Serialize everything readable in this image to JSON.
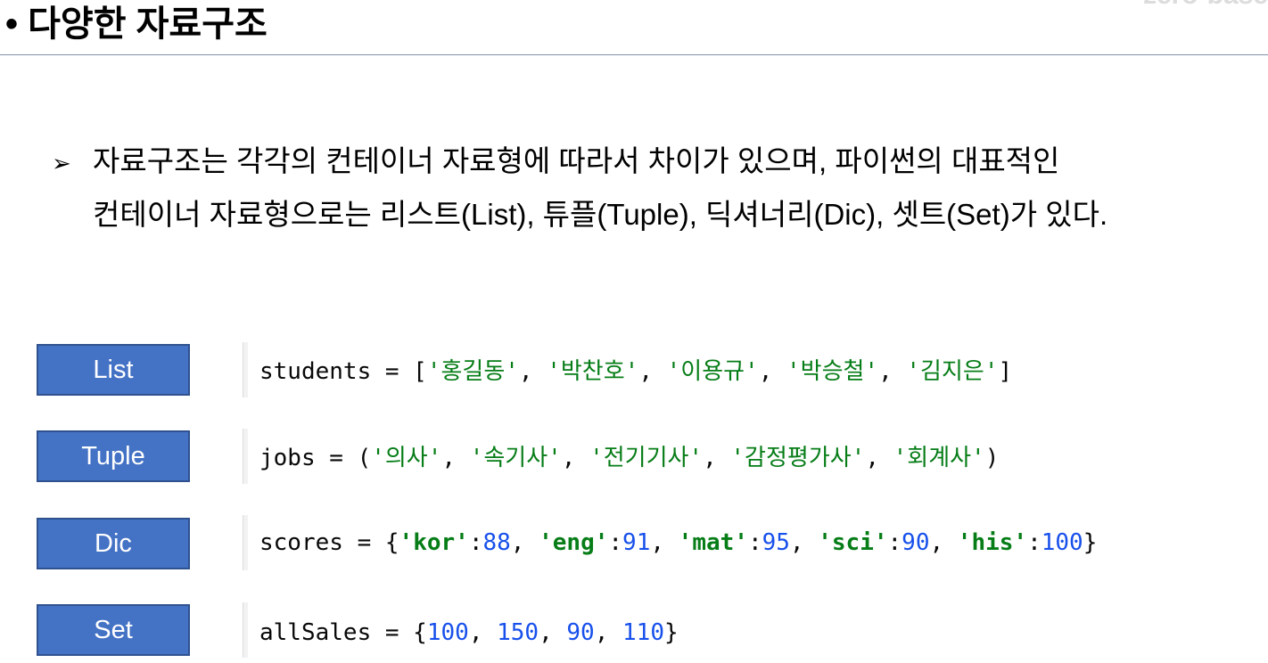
{
  "header": {
    "title": "• 다양한 자료구조",
    "watermark": "zero-base"
  },
  "paragraph": {
    "bullet": "➢",
    "line1": "자료구조는 각각의 컨테이너 자료형에 따라서 차이가 있으며, 파이썬의 대표적인",
    "line2": "컨테이너 자료형으로는 리스트(List), 튜플(Tuple), 딕셔너리(Dic), 셋트(Set)가 있다."
  },
  "rows": [
    {
      "label": "List",
      "code": [
        {
          "t": "students = [",
          "c": "plain"
        },
        {
          "t": "'홍길동'",
          "c": "str"
        },
        {
          "t": ", ",
          "c": "plain"
        },
        {
          "t": "'박찬호'",
          "c": "str"
        },
        {
          "t": ", ",
          "c": "plain"
        },
        {
          "t": "'이용규'",
          "c": "str"
        },
        {
          "t": ", ",
          "c": "plain"
        },
        {
          "t": "'박승철'",
          "c": "str"
        },
        {
          "t": ", ",
          "c": "plain"
        },
        {
          "t": "'김지은'",
          "c": "str"
        },
        {
          "t": "]",
          "c": "plain"
        }
      ]
    },
    {
      "label": "Tuple",
      "code": [
        {
          "t": "jobs = (",
          "c": "plain"
        },
        {
          "t": "'의사'",
          "c": "str"
        },
        {
          "t": ", ",
          "c": "plain"
        },
        {
          "t": "'속기사'",
          "c": "str"
        },
        {
          "t": ", ",
          "c": "plain"
        },
        {
          "t": "'전기기사'",
          "c": "str"
        },
        {
          "t": ", ",
          "c": "plain"
        },
        {
          "t": "'감정평가사'",
          "c": "str"
        },
        {
          "t": ", ",
          "c": "plain"
        },
        {
          "t": "'회계사'",
          "c": "str"
        },
        {
          "t": ")",
          "c": "plain"
        }
      ]
    },
    {
      "label": "Dic",
      "code": [
        {
          "t": "scores = {",
          "c": "plain"
        },
        {
          "t": "'kor'",
          "c": "key"
        },
        {
          "t": ":",
          "c": "plain"
        },
        {
          "t": "88",
          "c": "num"
        },
        {
          "t": ", ",
          "c": "plain"
        },
        {
          "t": "'eng'",
          "c": "key"
        },
        {
          "t": ":",
          "c": "plain"
        },
        {
          "t": "91",
          "c": "num"
        },
        {
          "t": ", ",
          "c": "plain"
        },
        {
          "t": "'mat'",
          "c": "key"
        },
        {
          "t": ":",
          "c": "plain"
        },
        {
          "t": "95",
          "c": "num"
        },
        {
          "t": ", ",
          "c": "plain"
        },
        {
          "t": "'sci'",
          "c": "key"
        },
        {
          "t": ":",
          "c": "plain"
        },
        {
          "t": "90",
          "c": "num"
        },
        {
          "t": ", ",
          "c": "plain"
        },
        {
          "t": "'his'",
          "c": "key"
        },
        {
          "t": ":",
          "c": "plain"
        },
        {
          "t": "100",
          "c": "num"
        },
        {
          "t": "}",
          "c": "plain"
        }
      ]
    },
    {
      "label": "Set",
      "code": [
        {
          "t": "allSales = {",
          "c": "plain"
        },
        {
          "t": "100",
          "c": "num"
        },
        {
          "t": ", ",
          "c": "plain"
        },
        {
          "t": "150",
          "c": "num"
        },
        {
          "t": ", ",
          "c": "plain"
        },
        {
          "t": "90",
          "c": "num"
        },
        {
          "t": ", ",
          "c": "plain"
        },
        {
          "t": "110",
          "c": "num"
        },
        {
          "t": "}",
          "c": "plain"
        }
      ]
    }
  ],
  "colors": {
    "label_bg": "#4472c4",
    "string": "#067d17",
    "number": "#1750eb"
  }
}
